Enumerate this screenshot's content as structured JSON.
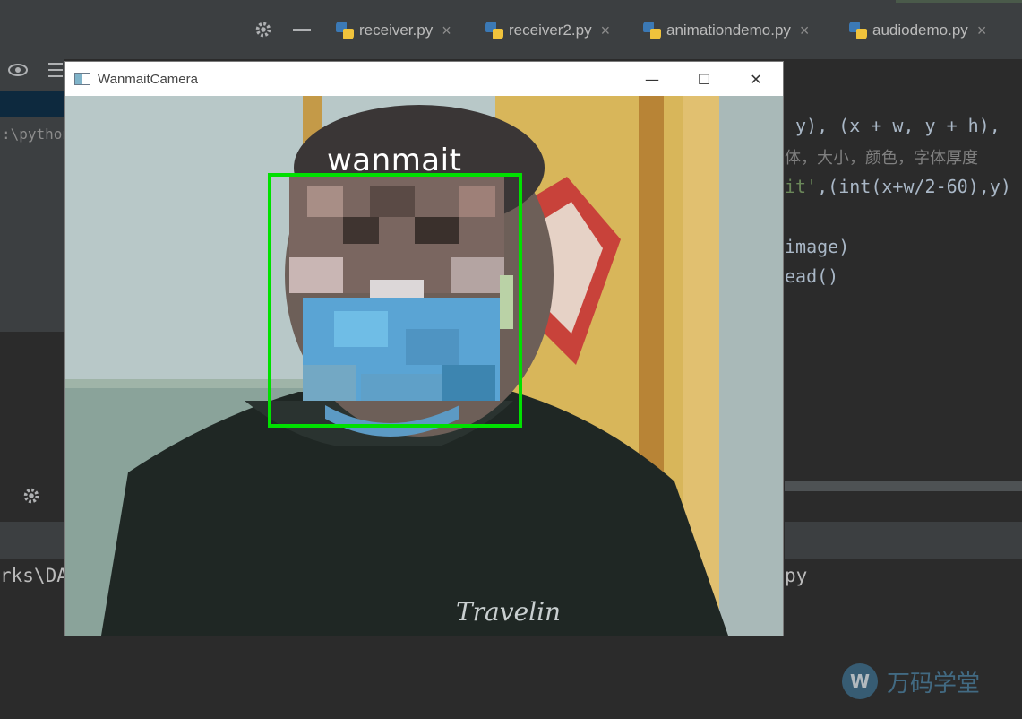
{
  "ide": {
    "left_path": ":\\pythonv",
    "tabs": [
      {
        "label": "receiver.py"
      },
      {
        "label": "receiver2.py"
      },
      {
        "label": "animationdemo.py"
      },
      {
        "label": "audiodemo.py"
      }
    ],
    "close_glyph": "×",
    "code_lines": {
      "line1": "y), (x + w, y + h),",
      "line2": "体，大小，颜色，字体厚度",
      "line3_str": "it'",
      "line3_rest": ",(int(x+w/2-60),y)",
      "line5": "image)",
      "line6": "ead()"
    },
    "console": {
      "left": "rks\\DA",
      "right": "py"
    }
  },
  "camera_window": {
    "title": "WanmaitCamera",
    "minimize": "—",
    "maximize": "☐",
    "close": "✕",
    "face_label": "wanmait",
    "box_color": "#00e000"
  },
  "watermark": {
    "logo": "W",
    "text": "万码学堂"
  },
  "colors": {
    "ide_bg": "#2b2b2b",
    "panel_bg": "#3c3f41",
    "keyword": "#cc7832",
    "number": "#6897bb"
  }
}
